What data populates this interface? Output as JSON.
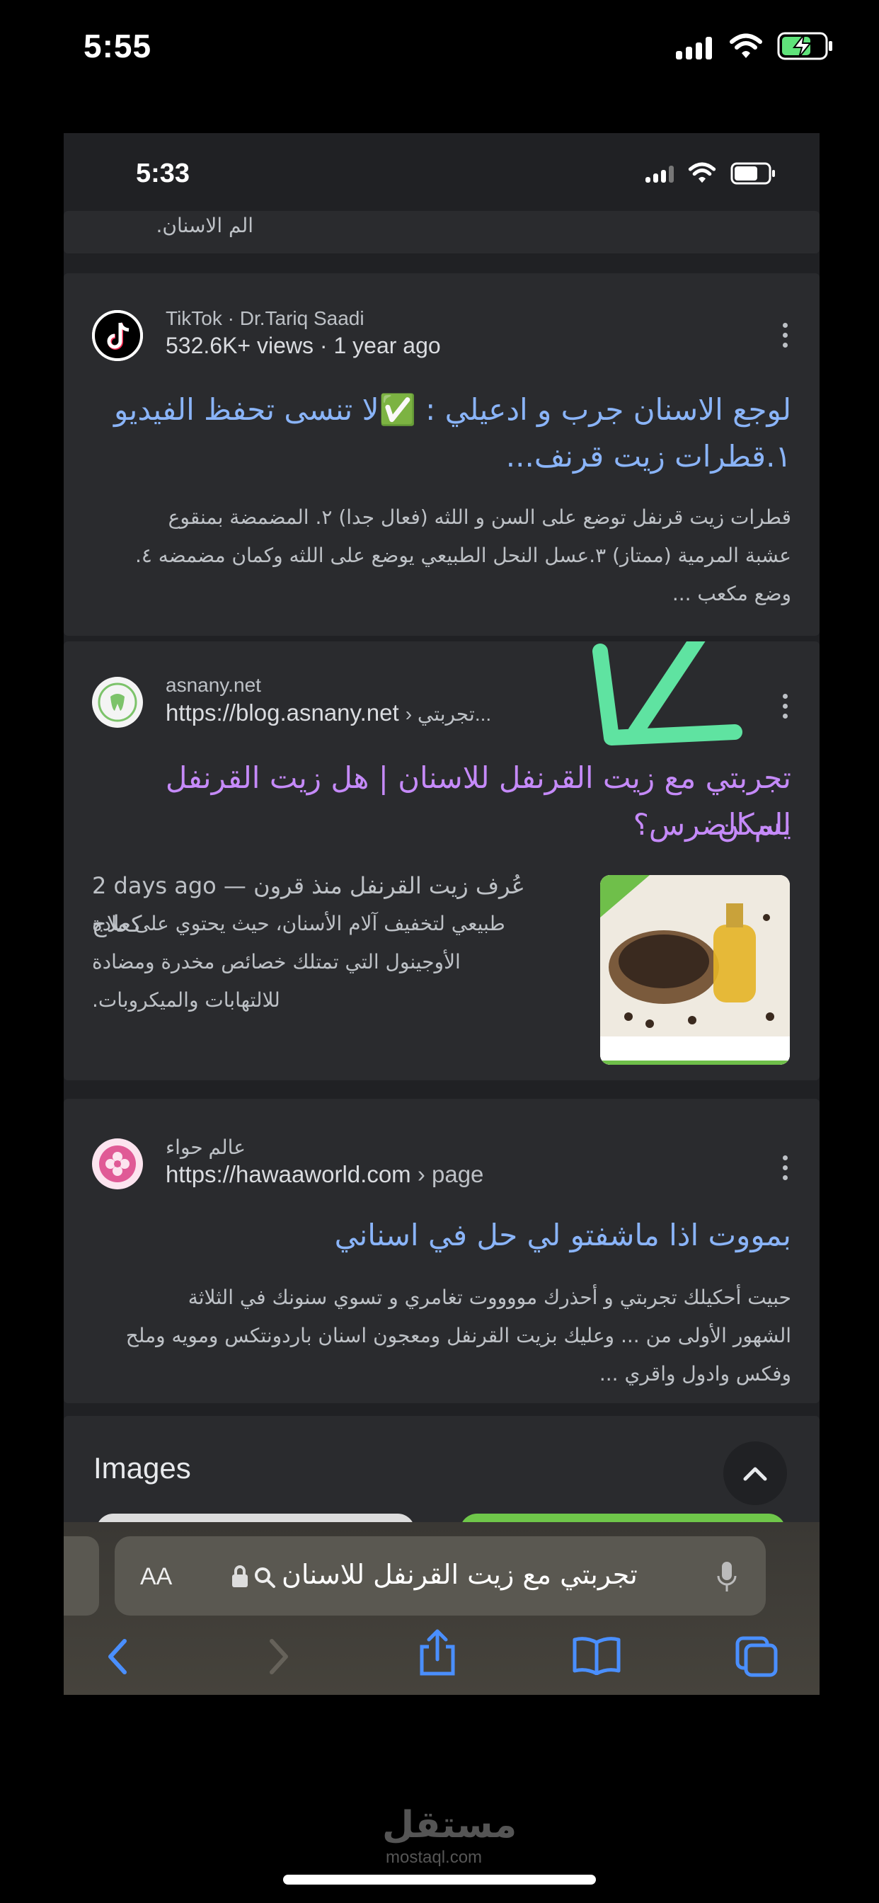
{
  "outer_status": {
    "time": "5:55"
  },
  "inner_status": {
    "time": "5:33"
  },
  "top_fragment": "الم الاسنان.",
  "results": [
    {
      "site": "TikTok · Dr.Tariq Saadi",
      "meta": "532.6K+ views · 1 year ago",
      "title_line1": "لوجع الاسنان جرب و ادعيلي : ✅لا تنسى تحفظ الفيديو",
      "title_line2": "١.قطرات زيت قرنف...",
      "snippet": [
        "قطرات زيت قرنفل توضع على السن و اللثه (فعال جدا) ٢. المضمضة بمنقوع",
        "عشبة المرمية (ممتاز) ٣.عسل النحل الطبيعي يوضع على اللثه وكمان مضمضه ٤.",
        "وضع مكعب ..."
      ]
    },
    {
      "site": "asnany.net",
      "url": "https://blog.asnany.net",
      "url_crumb": "› تجربتي...",
      "title_line1": "تجربتي مع زيت القرنفل للاسنان | هل زيت القرنفل يسكن",
      "title_line2": "الم الضرس؟",
      "date": "2 days ago —",
      "snippet": [
        "عُرف زيت القرنفل منذ قرون كعلاج",
        "طبيعي لتخفيف آلام الأسنان، حيث يحتوي على مادة",
        "الأوجينول التي تمتلك خصائص مخدرة ومضادة",
        "للالتهابات والميكروبات."
      ]
    },
    {
      "site": "عالم حواء",
      "url": "https://hawaaworld.com",
      "url_crumb": "› page",
      "title_line1": "بمووت اذا ماشفتو لي حل في اسناني",
      "snippet": [
        "حبيت أحكيلك تجربتي و أحذرك مووووت تغامري و تسوي سنونك في الثلاثة",
        "الشهور الأولى من ... وعليك بزيت القرنفل ومعجون اسنان باردونتكس ومويه وملح",
        "وفكس وادول واقري ..."
      ]
    }
  ],
  "images_heading": "Images",
  "address_bar": {
    "aa_label": "AA",
    "query": "تجربتي مع زيت القرنفل للاسنان"
  },
  "watermark": {
    "brand": "مستقل",
    "domain": "mostaql.com"
  },
  "colors": {
    "link_blue": "#8ab4f8",
    "visited_purple": "#c58af9",
    "arrow_green": "#5fe3a1"
  }
}
